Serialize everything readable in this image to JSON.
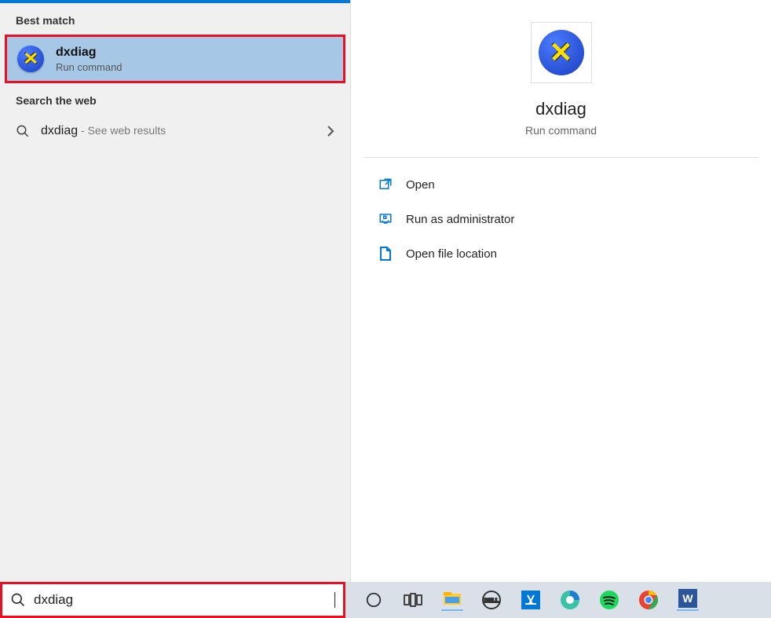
{
  "left": {
    "best_match_header": "Best match",
    "best_match": {
      "title": "dxdiag",
      "subtitle": "Run command"
    },
    "web_header": "Search the web",
    "web_item": {
      "title": "dxdiag",
      "subtitle": " - See web results"
    }
  },
  "right": {
    "hero_title": "dxdiag",
    "hero_subtitle": "Run command",
    "actions": [
      {
        "label": "Open"
      },
      {
        "label": "Run as administrator"
      },
      {
        "label": "Open file location"
      }
    ]
  },
  "taskbar": {
    "search_value": "dxdiag"
  }
}
